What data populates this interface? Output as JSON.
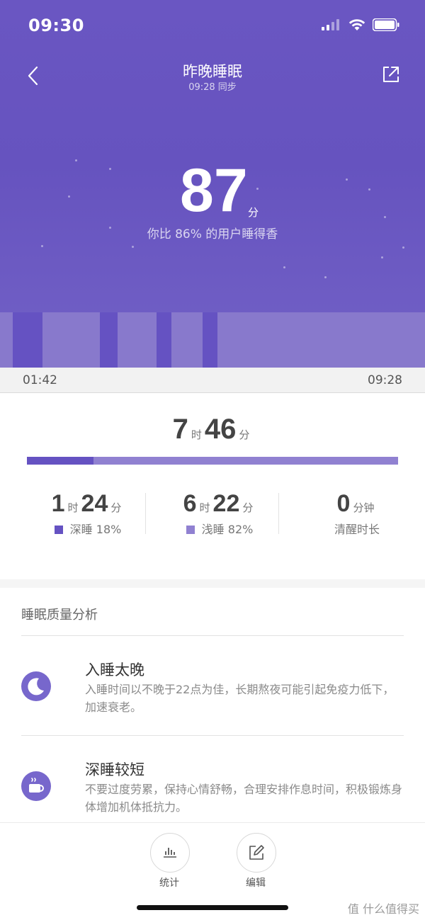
{
  "status_bar": {
    "time": "09:30"
  },
  "nav": {
    "title": "昨晚睡眠",
    "subtitle": "09:28 同步"
  },
  "score": {
    "value": "87",
    "unit": "分",
    "compare": "你比 86% 的用户睡得香"
  },
  "timeline": {
    "start": "01:42",
    "end": "09:28"
  },
  "total": {
    "hours": "7",
    "hours_unit": "时",
    "minutes": "46",
    "minutes_unit": "分"
  },
  "ratio": {
    "deep_fraction": 0.18
  },
  "stats": {
    "deep": {
      "hours": "1",
      "hours_unit": "时",
      "minutes": "24",
      "minutes_unit": "分",
      "label": "深睡 18%"
    },
    "light": {
      "hours": "6",
      "hours_unit": "时",
      "minutes": "22",
      "minutes_unit": "分",
      "label": "浅睡 82%"
    },
    "awake": {
      "value": "0",
      "unit": "分钟",
      "label": "清醒时长"
    }
  },
  "analysis": {
    "title": "睡眠质量分析",
    "items": [
      {
        "icon": "moon-icon",
        "title": "入睡太晚",
        "desc": "入睡时间以不晚于22点为佳，长期熬夜可能引起免疫力低下，加速衰老。"
      },
      {
        "icon": "coffee-cup-icon",
        "title": "深睡较短",
        "desc": "不要过度劳累，保持心情舒畅，合理安排作息时间，积极锻炼身体增加机体抵抗力。"
      }
    ]
  },
  "toolbar": {
    "stats_label": "统计",
    "edit_label": "编辑"
  },
  "watermark": "值 什么值得买",
  "colors": {
    "header": "#6653bf",
    "deep_sleep": "#6552c2",
    "light_sleep": "#8879cc",
    "icon_bg": "#7767cc"
  }
}
